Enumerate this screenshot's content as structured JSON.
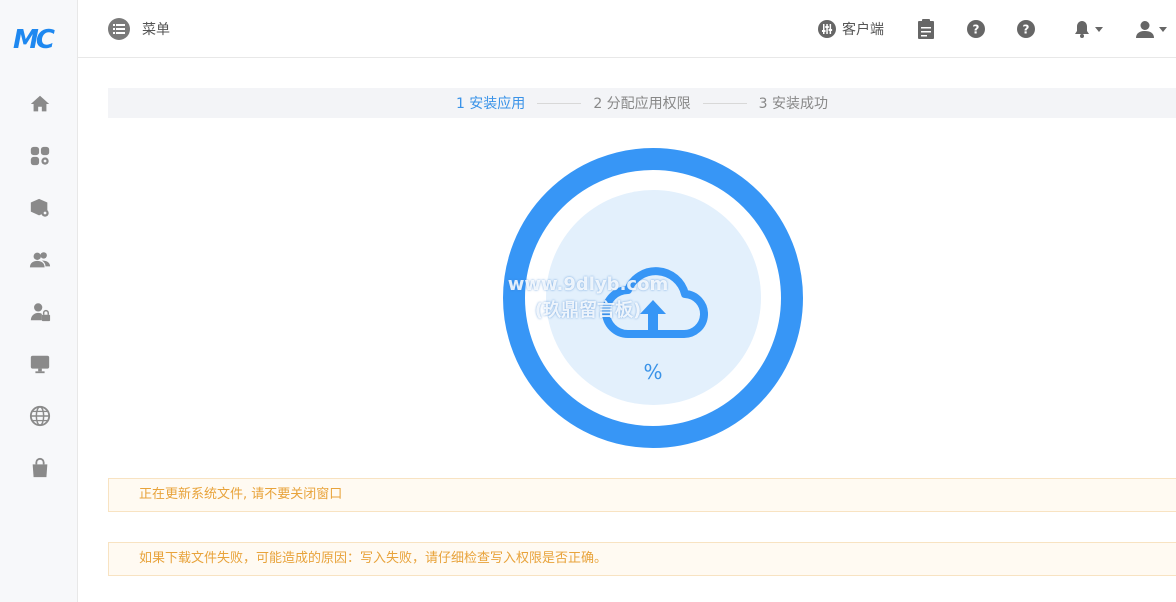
{
  "logo": {
    "text": "MC"
  },
  "sidebar": {
    "items": [
      {
        "name": "home"
      },
      {
        "name": "apps-settings"
      },
      {
        "name": "package-settings"
      },
      {
        "name": "users"
      },
      {
        "name": "user-lock"
      },
      {
        "name": "monitor"
      },
      {
        "name": "globe"
      },
      {
        "name": "bag"
      }
    ]
  },
  "header": {
    "menu_label": "菜单",
    "client_label": "客户端"
  },
  "steps": [
    {
      "label": "1 安装应用",
      "active": true
    },
    {
      "label": "2 分配应用权限",
      "active": false
    },
    {
      "label": "3 安装成功",
      "active": false
    }
  ],
  "progress": {
    "percent_text": "%",
    "ring_color": "#3796f6",
    "inner_color": "#e3f0fc"
  },
  "watermark": {
    "line1": "www.9dlyb.com",
    "line2": "(玖鼎留言板)"
  },
  "alerts": {
    "updating": "正在更新系统文件, 请不要关闭窗口",
    "failure_hint": "如果下载文件失败，可能造成的原因：写入失败，请仔细检查写入权限是否正确。"
  },
  "colors": {
    "accent": "#3a93e8",
    "warning_text": "#e8a33b"
  }
}
